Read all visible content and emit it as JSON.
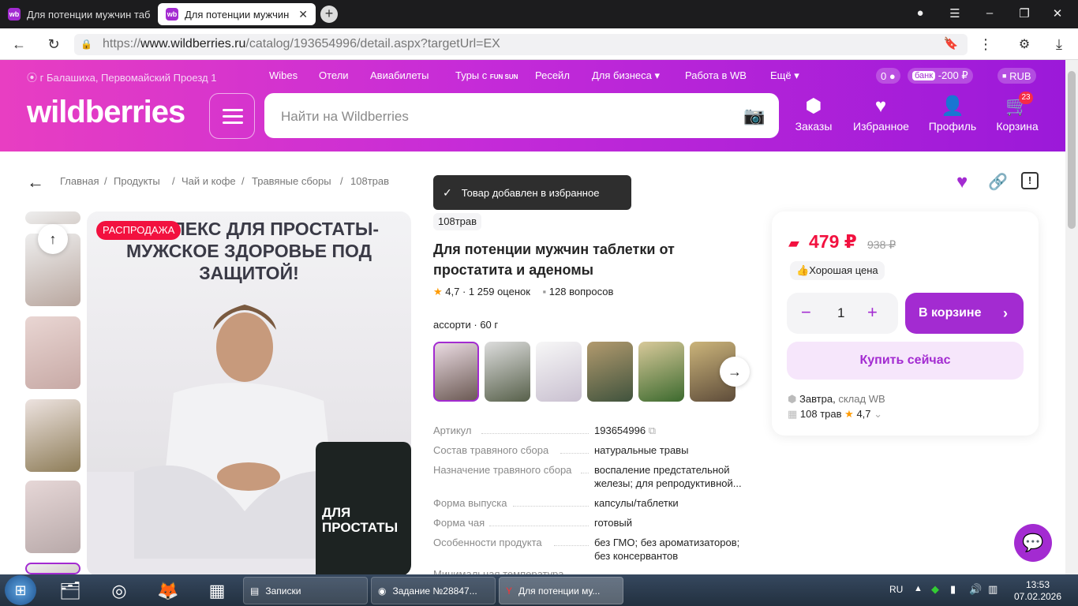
{
  "browser": {
    "tabs": [
      {
        "label": "Для потенции мужчин таб",
        "favicon": "wb"
      },
      {
        "label": "Для потенции мужчин",
        "favicon": "wb"
      }
    ],
    "url_prefix": "https://",
    "url_host": "www.wildberries.ru",
    "url_path": "/catalog/193654996/detail.aspx?targetUrl=EX"
  },
  "header": {
    "location": "г Балашиха, Первомайский Проезд 1",
    "links": [
      "Wibes",
      "Отели",
      "Авиабилеты",
      "Туры с",
      "Ресейл",
      "Для бизнеса",
      "Работа в WB",
      "Ещё"
    ],
    "tours_brand": "FUN SUN",
    "balance": "0",
    "bank_label": "банк",
    "bank_value": "-200 ₽",
    "currency": "RUB",
    "logo": "wildberries",
    "search_placeholder": "Найти на Wildberries",
    "nav": [
      {
        "label": "Заказы",
        "icon": "box-icon"
      },
      {
        "label": "Избранное",
        "icon": "heart-icon"
      },
      {
        "label": "Профиль",
        "icon": "user-icon"
      },
      {
        "label": "Корзина",
        "icon": "cart-icon"
      }
    ],
    "cart_count": "23"
  },
  "breadcrumbs": [
    "Главная",
    "Продукты",
    "Чай и кофе",
    "Травяные сборы",
    "108трав"
  ],
  "toast": "Товар добавлен в избранное",
  "product": {
    "sale_badge": "РАСПРОДАЖА",
    "image_headline": "КОМПЛЕКС ДЛЯ ПРОСТАТЫ- МУЖСКОЕ ЗДОРОВЬЕ ПОД ЗАЩИТОЙ!",
    "jar_label": "ДЛЯ ПРОСТАТЫ",
    "brand": "108трав",
    "title": "Для потенции мужчин таблетки от простатита и аденомы",
    "rating": "4,7",
    "reviews": "1 259 оценок",
    "questions": "128 вопросов",
    "variant_label": "ассорти · 60 г",
    "specs": [
      {
        "label": "Артикул",
        "value": "193654996"
      },
      {
        "label": "Состав травяного сбора",
        "value": "натуральные травы"
      },
      {
        "label": "Назначение травяного сбора",
        "value": "воспаление предстательной железы; для репродуктивной..."
      },
      {
        "label": "Форма выпуска",
        "value": "капсулы/таблетки"
      },
      {
        "label": "Форма чая",
        "value": "готовый"
      },
      {
        "label": "Особенности продукта",
        "value": "без ГМО; без ароматизаторов; без консервантов"
      }
    ],
    "more_spec_partial": "Минимальная температура"
  },
  "buybox": {
    "price": "479 ₽",
    "old_price": "938 ₽",
    "good_price": "Хорошая цена",
    "quantity": "1",
    "in_cart": "В корзине",
    "buy_now": "Купить сейчас",
    "delivery_day": "Завтра,",
    "delivery_source": "склад WB",
    "seller": "108 трав",
    "seller_rating": "4,7"
  },
  "taskbar": {
    "items": [
      "Записки",
      "Задание №28847...",
      "Для потенции му..."
    ],
    "lang": "RU",
    "time": "13:53",
    "date": "07.02.2026"
  },
  "colors": {
    "brand": "#a32bd1",
    "sale": "#f2113f",
    "header_start": "#e83ec2",
    "header_end": "#9b19d9"
  }
}
